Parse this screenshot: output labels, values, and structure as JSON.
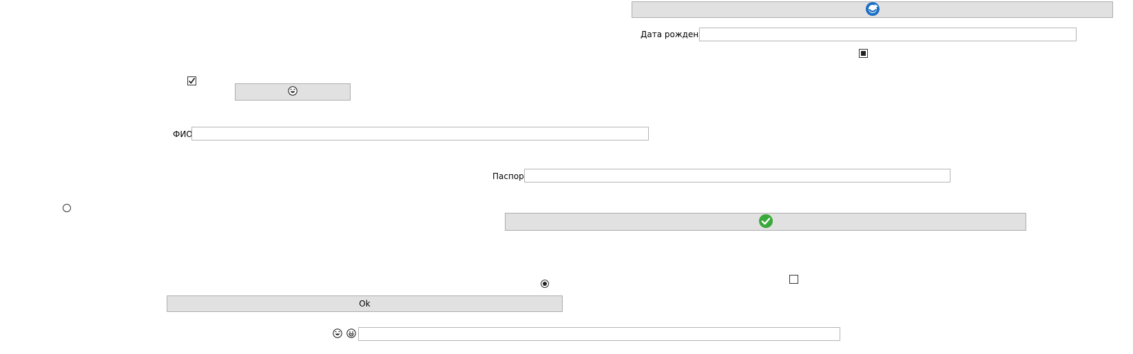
{
  "controls": {
    "top_button": {
      "icon": "blue-circle-arrow-icon"
    },
    "dob": {
      "label": "Дата рождения",
      "value": "",
      "placeholder": ""
    },
    "checkbox_top": {
      "state": "indeterminate"
    },
    "checkbox_left": {
      "state": "checked"
    },
    "emoji_button": {
      "icon": "laughing-face-icon"
    },
    "fio": {
      "label": "ФИО",
      "value": "",
      "placeholder": ""
    },
    "passport": {
      "label": "Паспорт",
      "value": "",
      "placeholder": ""
    },
    "radio_left": {
      "state": "unselected"
    },
    "check_button": {
      "icon": "green-check-circle-icon"
    },
    "radio_center": {
      "state": "selected"
    },
    "checkbox_right": {
      "state": "unchecked"
    },
    "ok_button": {
      "label": "Ok"
    },
    "bottom_field": {
      "icons": [
        "laughing-face-icon",
        "grinning-face-icon"
      ],
      "value": "",
      "placeholder": ""
    }
  }
}
